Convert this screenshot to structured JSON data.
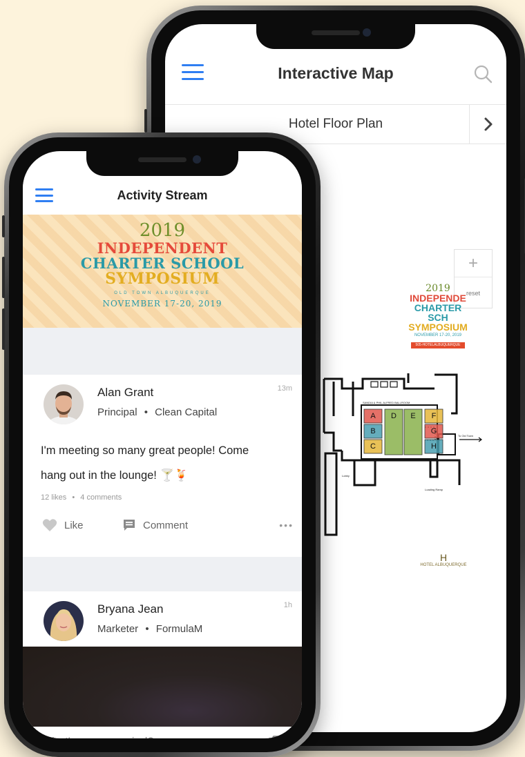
{
  "colors": {
    "background": "#fdf3dc",
    "accent": "#2f7ef2",
    "logo_red": "#e54a3a",
    "logo_teal": "#2a9aa7",
    "logo_yellow": "#e3ad21",
    "logo_green": "#6f8f2b"
  },
  "map_screen": {
    "title": "Interactive Map",
    "menu_icon": "hamburger-icon",
    "search_icon": "search-icon",
    "floor_selector": {
      "label": "Hotel Floor Plan",
      "next_icon": "chevron-right-icon"
    },
    "zoom": {
      "plus": "+",
      "reset": "reset"
    },
    "mini_logo": {
      "year": "2019",
      "line1": "INDEPENDE",
      "line2": "CHARTER SCH",
      "line3": "SYMPOSIUM",
      "dates": "NOVEMBER 17-20, 2019",
      "tag": "505-HOTELALBUQUERQUE"
    },
    "rooms": [
      "A",
      "B",
      "C",
      "D",
      "E",
      "F",
      "G",
      "H"
    ],
    "room_colors": {
      "A": "#e0584d",
      "B": "#4a9fb0",
      "C": "#e5b63a",
      "D": "#8ab14c",
      "E": "#8ab14c",
      "F": "#e5b63a",
      "G": "#e0584d",
      "H": "#4a9fb0"
    },
    "floor_labels": {
      "ballroom": "SANDIA & PHIL ALFRED BALLROOM",
      "to_old_town": "To Old Town",
      "loading": "Loading Ramp",
      "lobby": "Lobby"
    },
    "hotel_logo": {
      "mark": "H",
      "name": "HOTEL ALBUQUERQUE"
    }
  },
  "activity_screen": {
    "title": "Activity Stream",
    "menu_icon": "hamburger-icon",
    "banner": {
      "year": "2019",
      "line1": "INDEPENDENT",
      "line2": "CHARTER SCHOOL",
      "line3": "SYMPOSIUM",
      "place": "OLD TOWN ALBUQUERQUE",
      "dates": "NOVEMBER 17-20, 2019"
    },
    "posts": [
      {
        "name": "Alan Grant",
        "role": "Principal",
        "separator": "•",
        "company": "Clean Capital",
        "time": "13m",
        "text_line1": "I'm meeting so many great people! Come",
        "text_line2": "hang out in the lounge! 🍸🍹",
        "likes": "12 likes",
        "stats_sep": "•",
        "comments": "4 comments",
        "like_label": "Like",
        "comment_label": "Comment",
        "more": "•••"
      },
      {
        "name": "Bryana Jean",
        "role": "Marketer",
        "separator": "•",
        "company": "FormulaM",
        "time": "1h"
      }
    ],
    "composer": {
      "placeholder": "What's on your mind?",
      "value": "",
      "icon": "camera-plus-icon"
    }
  }
}
